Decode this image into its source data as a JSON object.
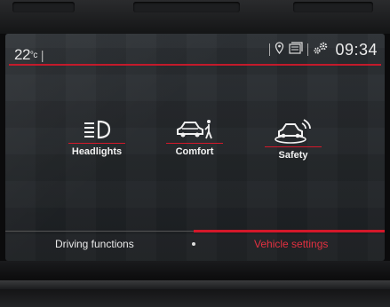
{
  "status_bar": {
    "temperature": "22",
    "temperature_unit": "°c",
    "separator": "|",
    "clock": "09:34",
    "icons": [
      "location-pin-icon",
      "media-source-icon",
      "settings-gears-icon"
    ]
  },
  "tiles": [
    {
      "label": "Headlights",
      "icon": "headlight-icon"
    },
    {
      "label": "Comfort",
      "icon": "car-person-icon"
    },
    {
      "label": "Safety",
      "icon": "car-signal-icon"
    }
  ],
  "bottom_nav": {
    "left_label": "Driving functions",
    "right_label": "Vehicle settings",
    "active": "right"
  },
  "colors": {
    "accent": "#d4182a",
    "text": "#f2f2f2",
    "screen_bg": "#24282b"
  }
}
